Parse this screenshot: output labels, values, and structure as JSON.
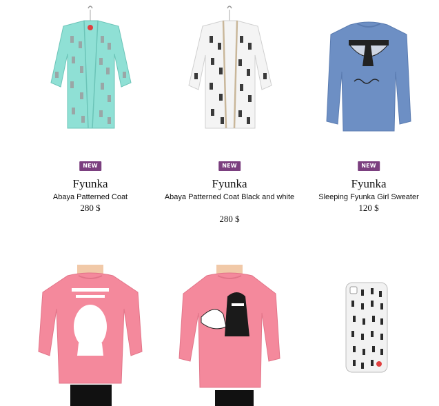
{
  "products": [
    {
      "badge": "NEW",
      "brand": "Fyunka",
      "name": "Abaya Patterned Coat",
      "price": "280 $"
    },
    {
      "badge": "NEW",
      "brand": "Fyunka",
      "name": "Abaya Patterned Coat Black and white",
      "price": "280 $"
    },
    {
      "badge": "NEW",
      "brand": "Fyunka",
      "name": "Sleeping Fyunka Girl Sweater",
      "price": "120 $"
    }
  ],
  "colors": {
    "badge": "#7b3f7f",
    "mint": "#8fe0d5",
    "blue_sweater": "#6d8fc4",
    "pink_sweater": "#f4899c"
  }
}
